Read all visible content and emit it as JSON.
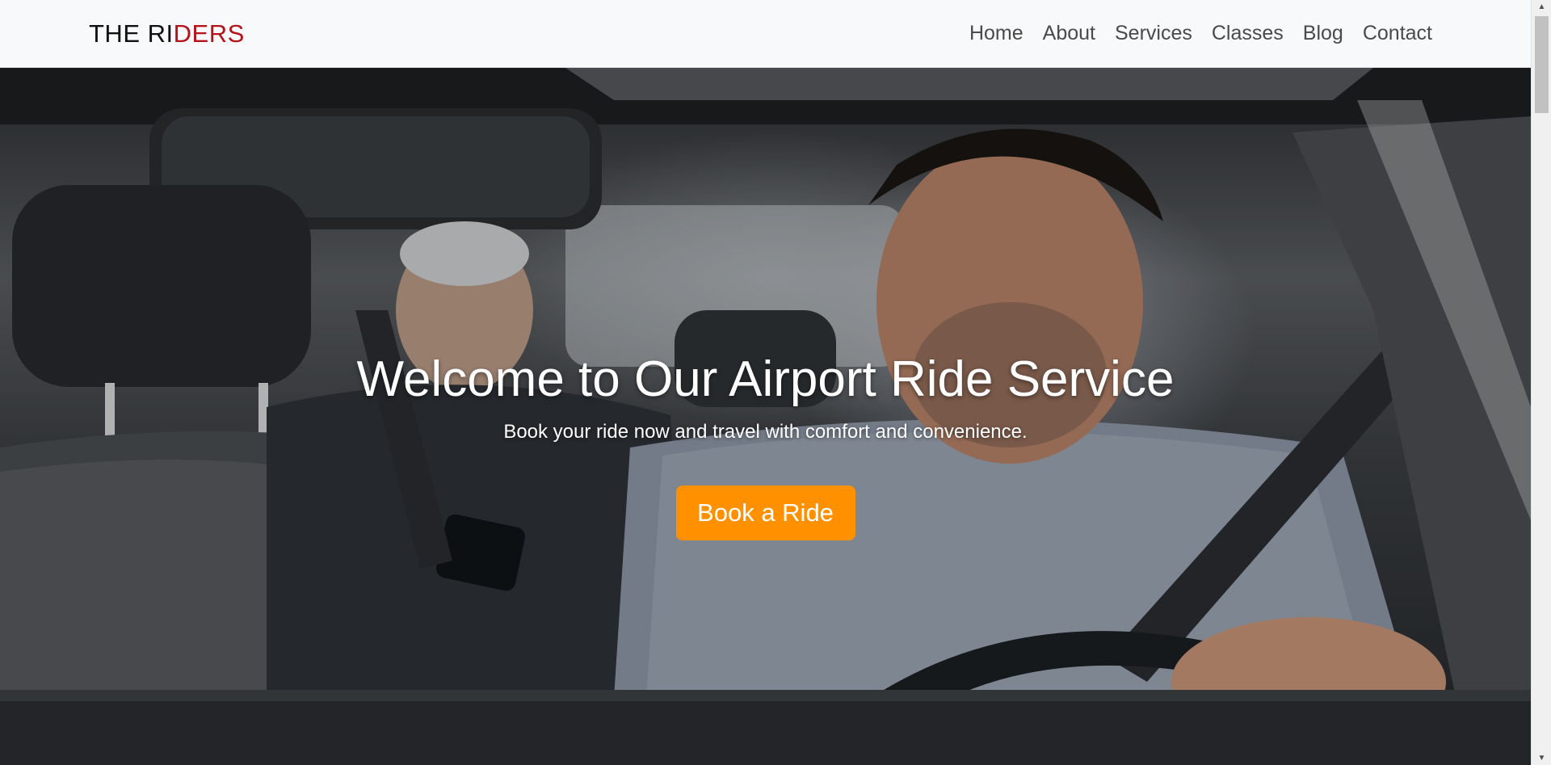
{
  "brand": {
    "part_dark": "THE RI",
    "part_red": "DERS"
  },
  "nav": {
    "items": [
      {
        "label": "Home"
      },
      {
        "label": "About"
      },
      {
        "label": "Services"
      },
      {
        "label": "Classes"
      },
      {
        "label": "Blog"
      },
      {
        "label": "Contact"
      }
    ]
  },
  "hero": {
    "title": "Welcome to Our Airport Ride Service",
    "subtitle": "Book your ride now and travel with comfort and convenience.",
    "button_label": "Book a Ride"
  },
  "colors": {
    "brand_red": "#b5121b",
    "button_orange": "#ff9100",
    "navbar_bg": "#f8f9fa"
  },
  "icons": {
    "scroll_up": "triangle-up-icon",
    "scroll_down": "triangle-down-icon"
  }
}
